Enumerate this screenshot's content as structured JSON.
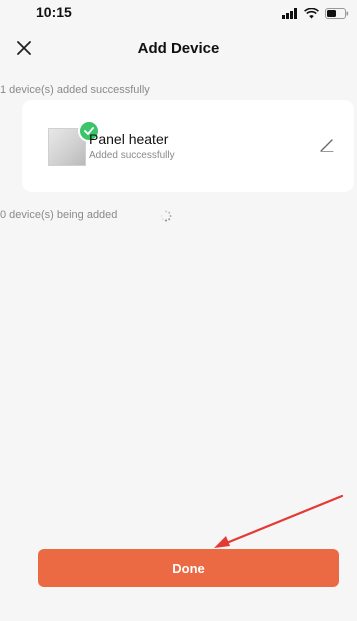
{
  "status_bar": {
    "time": "10:15"
  },
  "nav": {
    "title": "Add Device"
  },
  "added_section": {
    "label": "1 device(s) added successfully"
  },
  "device": {
    "name": "Panel heater",
    "status": "Added successfully",
    "icon": "panel-heater",
    "badge_color": "#3cc46b"
  },
  "pending_section": {
    "label": "0 device(s) being added"
  },
  "done_button": {
    "label": "Done",
    "color": "#ec6a43"
  },
  "annotation": {
    "arrow_color": "#e53935"
  }
}
